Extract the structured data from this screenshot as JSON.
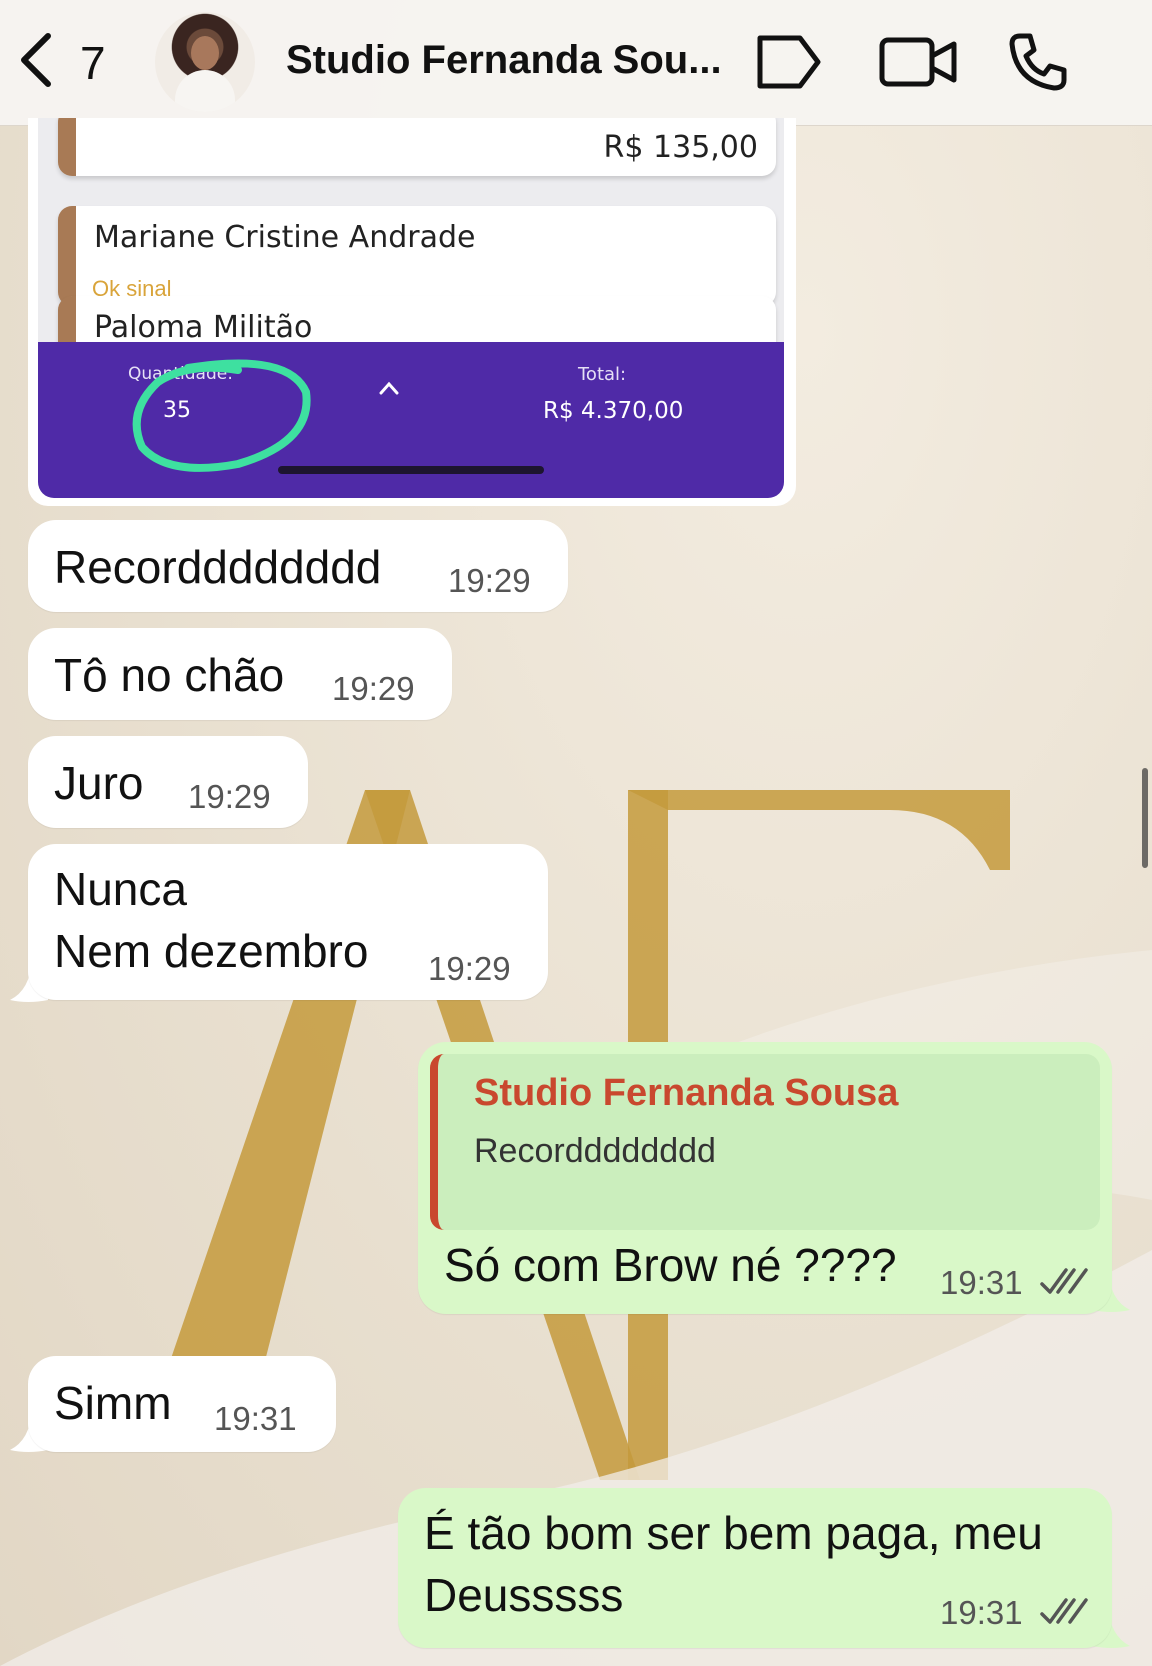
{
  "header": {
    "back_count": "7",
    "title": "Studio Fernanda Sou...",
    "icons": [
      "chevron-left-icon",
      "tag-icon",
      "video-call-icon",
      "phone-icon"
    ]
  },
  "screenshot_card": {
    "items": [
      {
        "name": "",
        "price": "R$ 135,00"
      },
      {
        "name": "Mariane Cristine Andrade",
        "note": "Ok sinal"
      },
      {
        "name": "Paloma Militão"
      }
    ],
    "quantity_label": "Quantidade:",
    "quantity_value": "35",
    "total_label": "Total:",
    "total_value": "R$ 4.370,00",
    "highlight_color": "#3ee0a0",
    "bar_color": "#4f2aa7"
  },
  "messages": [
    {
      "dir": "in",
      "text": "Recordddddddd",
      "time": "19:29"
    },
    {
      "dir": "in",
      "text": "Tô no chão",
      "time": "19:29"
    },
    {
      "dir": "in",
      "text": "Juro",
      "time": "19:29"
    },
    {
      "dir": "in",
      "line1": "Nunca",
      "line2": "Nem dezembro",
      "time": "19:29"
    },
    {
      "dir": "out",
      "quote_name": "Studio Fernanda Sousa",
      "quote_text": "Recordddddddd",
      "text": "Só com Brow né ????",
      "time": "19:31"
    },
    {
      "dir": "in",
      "text": "Simm",
      "time": "19:31"
    },
    {
      "dir": "out",
      "line1": "É tão bom ser bem paga, meu",
      "line2": "Deusssss",
      "time": "19:31"
    }
  ],
  "colors": {
    "outgoing_bubble": "#d9f8c8",
    "incoming_bubble": "#ffffff",
    "quote_accent": "#c9482e",
    "read_ticks": "#555555"
  }
}
